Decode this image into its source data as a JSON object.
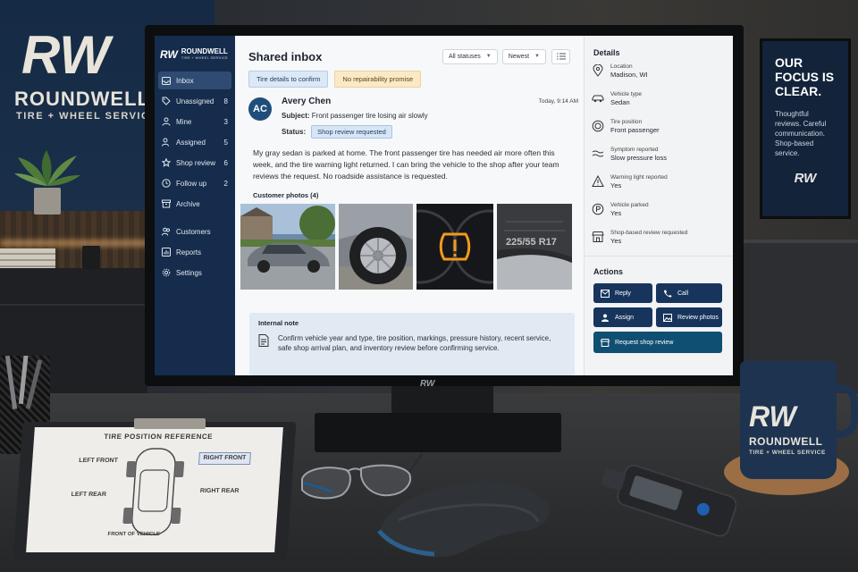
{
  "scene": {
    "brand": {
      "mark": "RW",
      "name": "ROUNDWELL",
      "sub": "TIRE + WHEEL SERVICE"
    },
    "poster": {
      "title": "OUR FOCUS IS CLEAR.",
      "body": "Thoughtful reviews. Careful communication. Shop-based service.",
      "logo": "RW"
    },
    "monitor_brand": "RW",
    "mug": {
      "mark": "RW",
      "name": "ROUNDWELL",
      "sub": "TIRE + WHEEL SERVICE"
    },
    "clipboard": {
      "title": "TIRE POSITION REFERENCE",
      "left_front": "LEFT FRONT",
      "right_front": "RIGHT FRONT",
      "left_rear": "LEFT REAR",
      "right_rear": "RIGHT REAR",
      "front": "FRONT OF VEHICLE"
    }
  },
  "app": {
    "logo": {
      "mark": "RW",
      "name": "ROUNDWELL",
      "sub": "TIRE + WHEEL SERVICE"
    },
    "nav": [
      {
        "label": "Inbox",
        "count": "",
        "icon": "inbox-icon",
        "active": true
      },
      {
        "label": "Unassigned",
        "count": "8",
        "icon": "tag-icon"
      },
      {
        "label": "Mine",
        "count": "3",
        "icon": "user-icon"
      },
      {
        "label": "Assigned",
        "count": "5",
        "icon": "user-check-icon"
      },
      {
        "label": "Shop review",
        "count": "6",
        "icon": "star-icon"
      },
      {
        "label": "Follow up",
        "count": "2",
        "icon": "clock-icon"
      },
      {
        "label": "Archive",
        "count": "",
        "icon": "archive-icon"
      },
      {
        "label": "Customers",
        "count": "",
        "icon": "users-icon"
      },
      {
        "label": "Reports",
        "count": "",
        "icon": "chart-icon"
      },
      {
        "label": "Settings",
        "count": "",
        "icon": "gear-icon"
      }
    ],
    "main": {
      "title": "Shared inbox",
      "status_filter": "All statuses",
      "sort": "Newest",
      "chips": [
        "Tire details to confirm",
        "No repairability promise"
      ],
      "message": {
        "initials": "AC",
        "sender": "Avery Chen",
        "date": "Today, 9:14 AM",
        "subject_label": "Subject:",
        "subject": "Front passenger tire losing air slowly",
        "status_label": "Status:",
        "status": "Shop review requested",
        "body": "My gray sedan is parked at home. The front passenger tire has needed air more often this week, and the tire warning light returned. I can bring the vehicle to the shop after your team reviews the request. No roadside assistance is requested."
      },
      "photos_label": "Customer photos (4)",
      "photo_tire_marking": "225/55 R17",
      "note": {
        "title": "Internal note",
        "text": "Confirm vehicle year and type, tire position, markings, pressure history, recent service, safe shop arrival plan, and inventory review before confirming service."
      }
    },
    "details": {
      "title": "Details",
      "rows": [
        {
          "label": "Location",
          "value": "Madison, WI",
          "icon": "location-pin-icon"
        },
        {
          "label": "Vehicle type",
          "value": "Sedan",
          "icon": "car-icon"
        },
        {
          "label": "Tire position",
          "value": "Front passenger",
          "icon": "tire-icon"
        },
        {
          "label": "Symptom reported",
          "value": "Slow pressure loss",
          "icon": "waves-icon"
        },
        {
          "label": "Warning light reported",
          "value": "Yes",
          "icon": "warning-icon"
        },
        {
          "label": "Vehicle parked",
          "value": "Yes",
          "icon": "parking-icon"
        },
        {
          "label": "Shop-based review requested",
          "value": "Yes",
          "icon": "shop-icon"
        }
      ],
      "actions_title": "Actions",
      "actions": {
        "reply": "Reply",
        "call": "Call",
        "assign": "Assign",
        "review_photos": "Review photos",
        "request_review": "Request shop review"
      }
    }
  }
}
